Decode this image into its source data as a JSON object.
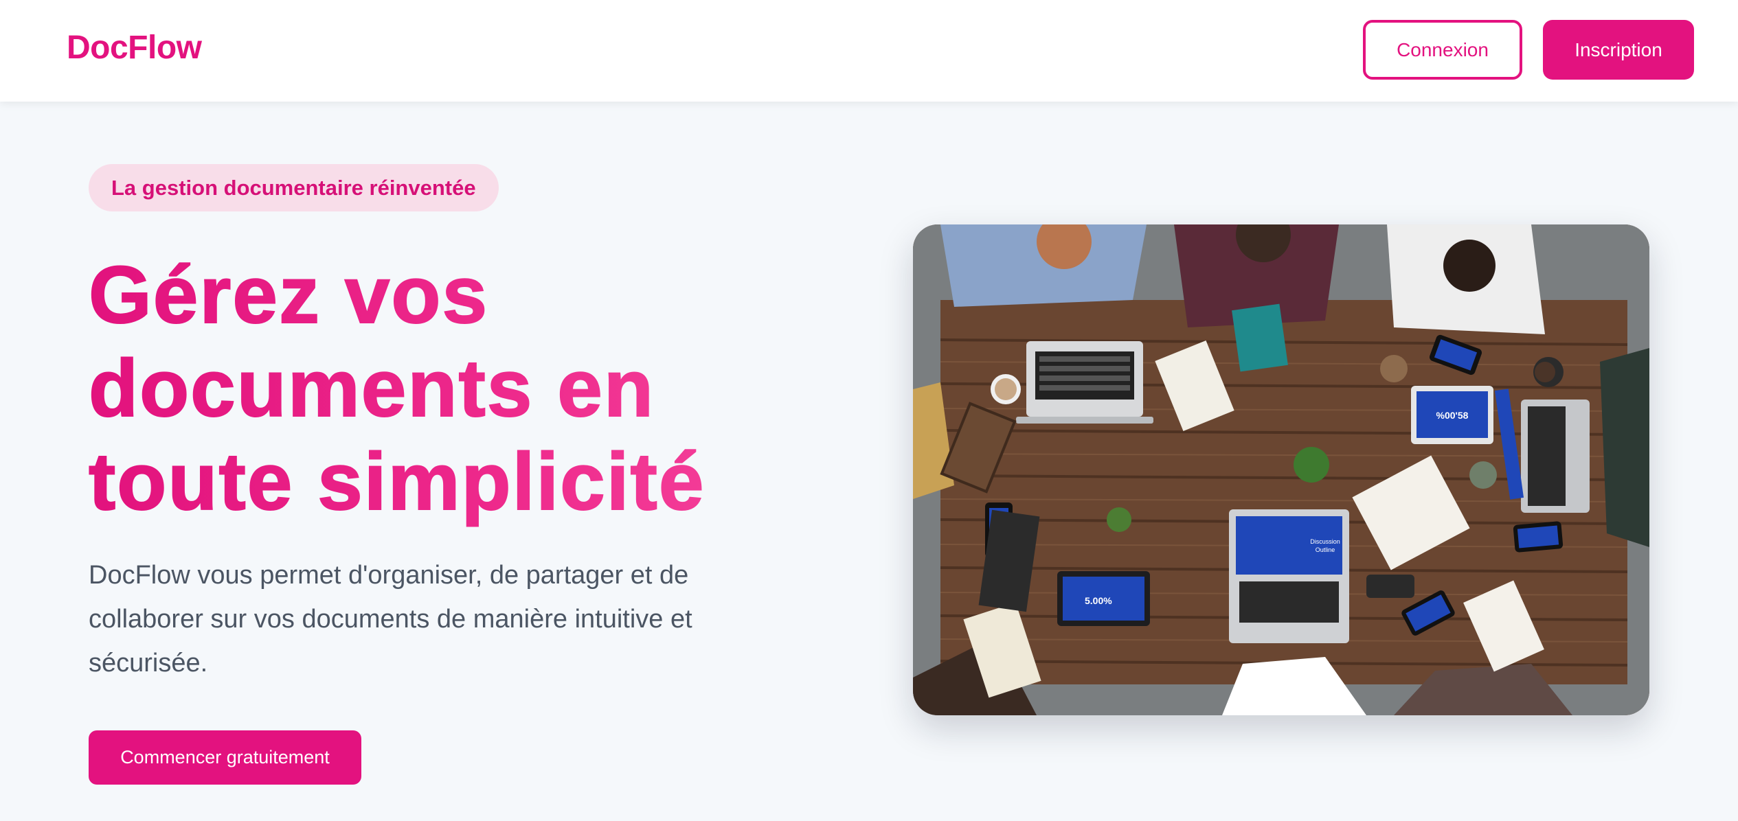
{
  "header": {
    "logo": "DocFlow",
    "login_label": "Connexion",
    "signup_label": "Inscription"
  },
  "hero": {
    "badge": "La gestion documentaire réinventée",
    "title_lines": [
      "Gérez vos",
      "documents en",
      "toute simplicité"
    ],
    "description": "DocFlow vous permet d'organiser, de partager et de collaborer sur vos documents de manière intuitive et sécurisée.",
    "cta_label": "Commencer gratuitement",
    "image_screen_texts": [
      "%00'58",
      "5.00%",
      "Discussion Outline"
    ]
  },
  "colors": {
    "brand": "#e3127f",
    "background": "#f5f8fb",
    "badge_bg": "#f8dde9",
    "text_muted": "#4b5563"
  }
}
